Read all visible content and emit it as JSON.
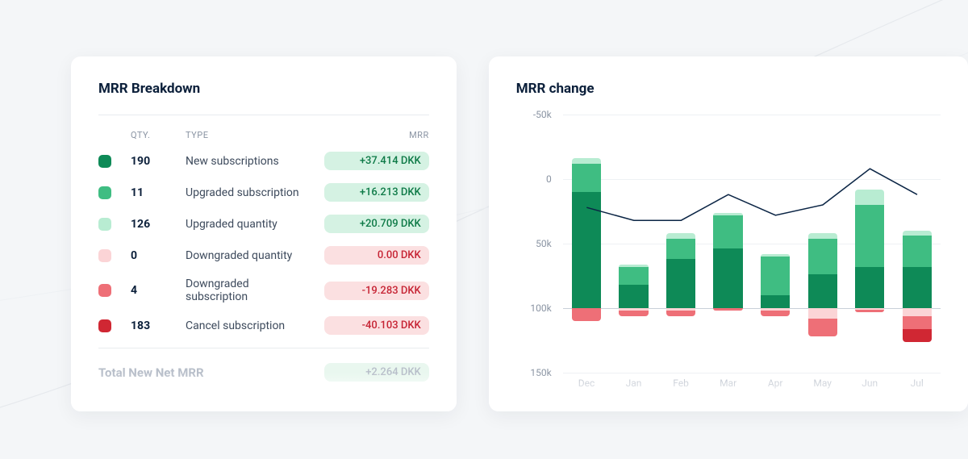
{
  "breakdown": {
    "title": "MRR Breakdown",
    "columns": {
      "qty": "QTY.",
      "type": "TYPE",
      "mrr": "MRR"
    },
    "rows": [
      {
        "color": "#0e8a57",
        "qty": "190",
        "type": "New subscriptions",
        "mrr": "+37.414 DKK",
        "sign": "pos"
      },
      {
        "color": "#3fbd82",
        "qty": "11",
        "type": "Upgraded subscription",
        "mrr": "+16.213 DKK",
        "sign": "pos"
      },
      {
        "color": "#b8ecd2",
        "qty": "126",
        "type": "Upgraded quantity",
        "mrr": "+20.709 DKK",
        "sign": "pos"
      },
      {
        "color": "#fbd4d6",
        "qty": "0",
        "type": "Downgraded quantity",
        "mrr": "0.00 DKK",
        "sign": "neg"
      },
      {
        "color": "#ee6f77",
        "qty": "4",
        "type": "Downgraded subscription",
        "mrr": "-19.283 DKK",
        "sign": "neg"
      },
      {
        "color": "#d02733",
        "qty": "183",
        "type": "Cancel subscription",
        "mrr": "-40.103 DKK",
        "sign": "neg"
      }
    ],
    "total": {
      "label": "Total New Net MRR",
      "value": "+2.264 DKK"
    }
  },
  "chart": {
    "title": "MRR change",
    "y_ticks": [
      "150k",
      "100k",
      "50k",
      "0",
      "-50k"
    ]
  },
  "chart_data": {
    "type": "bar",
    "title": "MRR change",
    "xlabel": "",
    "ylabel": "",
    "ylim": [
      -50,
      150
    ],
    "y_ticks": [
      -50,
      0,
      50,
      100,
      150
    ],
    "categories": [
      "Dec",
      "Jan",
      "Feb",
      "Mar",
      "Apr",
      "May",
      "Jun",
      "Jul"
    ],
    "series": [
      {
        "name": "New subscriptions",
        "color": "#0e8a57",
        "values": [
          90,
          18,
          38,
          46,
          10,
          26,
          32,
          32
        ]
      },
      {
        "name": "Upgraded subscription",
        "color": "#3fbd82",
        "values": [
          22,
          14,
          16,
          26,
          30,
          28,
          48,
          24
        ]
      },
      {
        "name": "Upgraded quantity",
        "color": "#b8ecd2",
        "values": [
          4,
          2,
          4,
          2,
          2,
          4,
          12,
          4
        ]
      },
      {
        "name": "Downgraded quantity",
        "color": "#fbd4d6",
        "values": [
          0,
          -2,
          -2,
          0,
          -2,
          -8,
          -1,
          -6
        ]
      },
      {
        "name": "Downgraded subscription",
        "color": "#ee6f77",
        "values": [
          -10,
          -4,
          -4,
          -2,
          -4,
          -14,
          -2,
          -10
        ]
      },
      {
        "name": "Cancel subscription",
        "color": "#d02733",
        "values": [
          0,
          0,
          0,
          0,
          0,
          0,
          0,
          -10
        ]
      }
    ],
    "overlays": [
      {
        "name": "Net MRR",
        "type": "line",
        "color": "#0b2545",
        "values": [
          78,
          68,
          68,
          88,
          72,
          80,
          108,
          88
        ]
      }
    ]
  },
  "colors": {
    "pos_bg": "#d5f2e3",
    "pos_fg": "#0e7a47",
    "neg_bg": "#fbe0e1",
    "neg_fg": "#c62434"
  }
}
